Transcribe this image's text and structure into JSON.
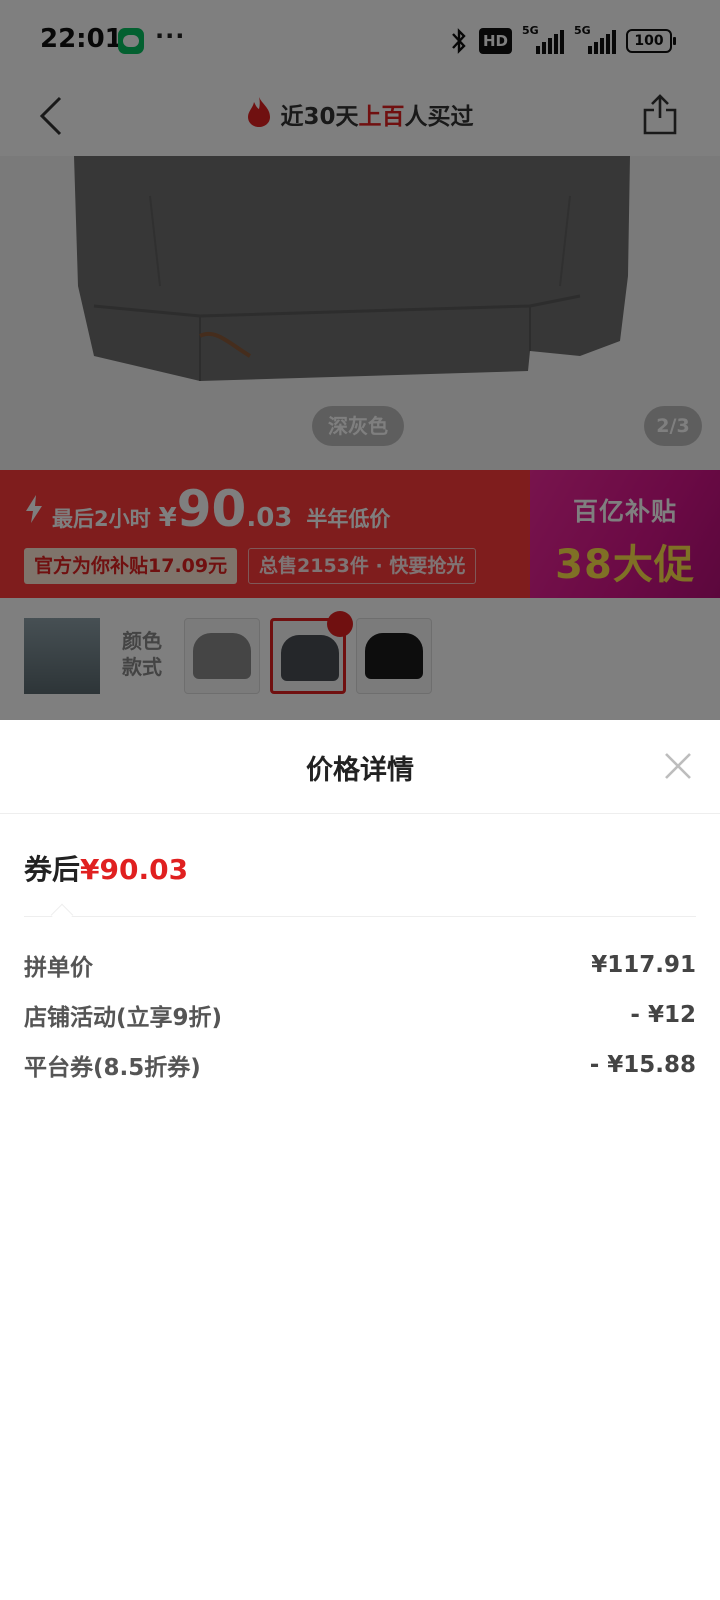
{
  "status_bar": {
    "time": "22:01",
    "dots": "···",
    "hd": "HD",
    "network_1": "5G",
    "network_2": "5G",
    "battery": "100"
  },
  "nav": {
    "title_prefix": "近30天",
    "title_highlight": "上百",
    "title_suffix": "人买过"
  },
  "hero": {
    "color_label": "深灰色",
    "page_indicator": "2/3"
  },
  "promo": {
    "timer_text": "最后2小时",
    "price_symbol": "¥",
    "price_int": "90",
    "price_dec": ".03",
    "low_price_text": "半年低价",
    "subsidy_chip": "官方为你补贴17.09元",
    "sold_chip": "总售2153件 · 快要抢光",
    "badge_line1": "百亿补贴",
    "badge_line2": "38大促"
  },
  "sku": {
    "label_line1": "颜色",
    "label_line2": "款式",
    "options": [
      "gray-sweater",
      "dark-gray-sweater",
      "black-sweater"
    ],
    "selected_index": 1
  },
  "sheet": {
    "title": "价格详情",
    "final_label": "券后",
    "final_price": "¥90.03",
    "rows": [
      {
        "label": "拼单价",
        "value": "¥117.91"
      },
      {
        "label": "店铺活动(立享9折)",
        "value": "- ¥12"
      },
      {
        "label": "平台券(8.5折券)",
        "value": "- ¥15.88"
      }
    ]
  },
  "colors": {
    "accent_red": "#e02020",
    "promo_red": "#ff3a3a",
    "subsidy_pink": "#d6148a"
  }
}
